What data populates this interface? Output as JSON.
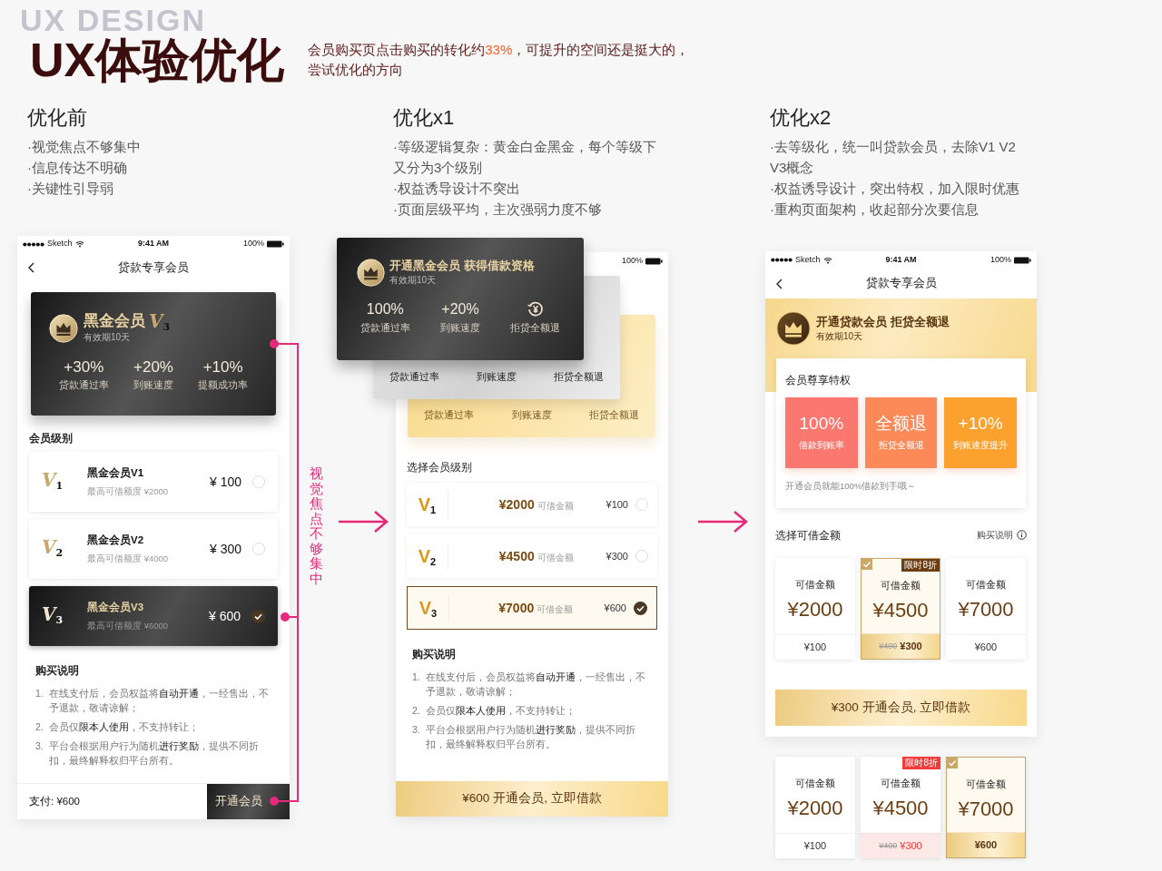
{
  "header": {
    "backdrop": "UX DESIGN",
    "title": "UX体验优化",
    "intro": {
      "lead": "会员购买页点击购买的转化约",
      "figure": "33%",
      "rest": "，可提升的空间还是挺大的，",
      "line2": "尝试优化的方向"
    }
  },
  "sections": [
    {
      "heading": "优化前",
      "points": [
        "·视觉焦点不够集中",
        "·信息传达不明确",
        "·关键性引导弱"
      ]
    },
    {
      "heading": "优化x1",
      "points": [
        "·等级逻辑复杂：黄金白金黑金，每个等级下又分为3个级别",
        "·权益诱导设计不突出",
        "·页面层级平均，主次强弱力度不够"
      ]
    },
    {
      "heading": "优化x2",
      "points": [
        "·去等级化，统一叫贷款会员，去除V1 V2 V3概念",
        "·权益诱导设计，突出特权，加入限时优惠",
        "·重构页面架构，收起部分次要信息"
      ]
    }
  ],
  "annotation": "视觉焦点不够集中",
  "before": {
    "status": {
      "carrier": "Sketch",
      "time": "9:41 AM",
      "battery": "100%"
    },
    "nav_title": "贷款专享会员",
    "card": {
      "title": "黑金会员",
      "badge": "V$_{3}$",
      "validity": "有效期10天",
      "stats": [
        {
          "value": "+30%",
          "label": "贷款通过率"
        },
        {
          "value": "+20%",
          "label": "到账速度"
        },
        {
          "value": "+10%",
          "label": "提额成功率"
        }
      ]
    },
    "levels_title": "会员级别",
    "levels": [
      {
        "logo": "V$_{1}$",
        "name": "黑金会员V1",
        "limit": "最高可借额度 ¥2000",
        "price": "¥ 100",
        "selected": false
      },
      {
        "logo": "V$_{2}$",
        "name": "黑金会员V2",
        "limit": "最高可借额度 ¥4000",
        "price": "¥ 300",
        "selected": false
      },
      {
        "logo": "V$_{3}$",
        "name": "黑金会员V3",
        "limit": "最高可借额度 ¥6000",
        "price": "¥ 600",
        "selected": true
      }
    ],
    "notes_title": "购买说明",
    "notes": [
      {
        "number": "1.",
        "text": "在线支付后，会员权益将**自动开通**，一经售出，不予退款，敬请谅解；"
      },
      {
        "number": "2.",
        "text": "会员仅**限本人使用**，不支持转让；"
      },
      {
        "number": "3.",
        "text": "平台会根据用户行为随机**进行奖励**，提供不同折扣，最终解释权归平台所有。"
      }
    ],
    "footer": {
      "pay": "支付: ¥600",
      "button": "开通会员"
    }
  },
  "first": {
    "status": {
      "battery": "100%"
    },
    "stack": [
      {
        "kind": "black",
        "title": "开通黑金会员 获得借款资格",
        "validity": "有效期10天",
        "stats": [
          {
            "kind": "text",
            "value": "100%",
            "label": "贷款通过率"
          },
          {
            "kind": "text",
            "value": "+20%",
            "label": "到账速度"
          },
          {
            "kind": "icon",
            "label": "拒贷全额退"
          }
        ]
      },
      {
        "kind": "silver",
        "labels": [
          "贷款通过率",
          "到账速度",
          "拒贷全额退"
        ]
      },
      {
        "kind": "gold",
        "labels": [
          "贷款通过率",
          "到账速度",
          "拒贷全额退"
        ]
      }
    ],
    "levels_title": "选择会员级别",
    "levels": [
      {
        "logo": "V$_{1}$",
        "amount": "¥2000",
        "amount_label": "可借金额",
        "price": "¥100",
        "selected": false
      },
      {
        "logo": "V$_{2}$",
        "amount": "¥4500",
        "amount_label": "可借金额",
        "price": "¥300",
        "selected": false
      },
      {
        "logo": "V$_{3}$",
        "amount": "¥7000",
        "amount_label": "可借金额",
        "price": "¥600",
        "selected": true
      }
    ],
    "notes_title": "购买说明",
    "notes": [
      {
        "number": "1.",
        "text": "在线支付后，会员权益将**自动开通**，一经售出，不予退款，敬请谅解；"
      },
      {
        "number": "2.",
        "text": "会员仅**限本人使用**，不支持转让；"
      },
      {
        "number": "3.",
        "text": "平台会根据用户行为随机**进行奖励**，提供不同折扣，最终解释权归平台所有。"
      }
    ],
    "button": "¥600 开通会员, 立即借款"
  },
  "second": {
    "status": {
      "carrier": "Sketch",
      "time": "9:41 AM",
      "battery": "100%"
    },
    "nav_title": "贷款专享会员",
    "banner": {
      "title": "开通贷款会员 拒贷全额退",
      "validity": "有效期10天"
    },
    "perks": {
      "title": "会员尊享特权",
      "items": [
        {
          "value": "100%",
          "label": "借款到账率",
          "color": "#fb7870"
        },
        {
          "value": "全额退",
          "label": "拒贷全额退",
          "color": "#fb8a58"
        },
        {
          "value": "+10%",
          "label": "到账速度提升",
          "color": "#fca12e"
        }
      ],
      "note": "开通会员就能100%借款到手哦～"
    },
    "amounts_title": "选择可借金额",
    "help": "购买说明",
    "amounts": [
      {
        "label": "可借金额",
        "amount": "¥2000",
        "price": "¥100",
        "selected": false
      },
      {
        "label": "可借金额",
        "amount": "¥4500",
        "badge": "限时8折",
        "old_price": "¥400",
        "price": "¥300",
        "selected": true
      },
      {
        "label": "可借金额",
        "amount": "¥7000",
        "price": "¥600",
        "selected": false
      }
    ],
    "button": "¥300 开通会员, 立即借款",
    "variant": [
      {
        "label": "可借金额",
        "amount": "¥2000",
        "price": "¥100",
        "selected": false
      },
      {
        "label": "可借金额",
        "amount": "¥4500",
        "badge": "限时8折",
        "old_price": "¥400",
        "price": "¥300",
        "selected": false
      },
      {
        "label": "可借金额",
        "amount": "¥7000",
        "price": "¥600",
        "selected": true
      }
    ]
  }
}
